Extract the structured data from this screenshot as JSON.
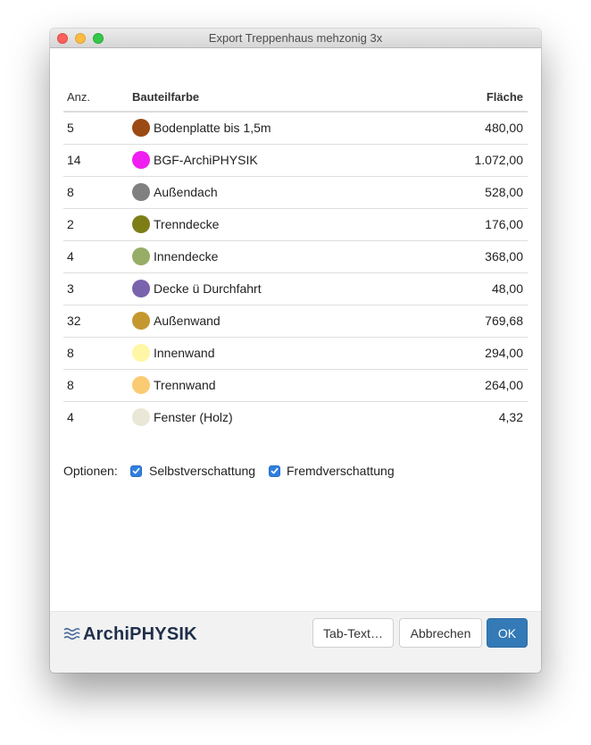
{
  "window": {
    "title": "Export Treppenhaus mehzonig 3x"
  },
  "table": {
    "headers": {
      "anz": "Anz.",
      "farbe": "Bauteilfarbe",
      "flaeche": "Fläche"
    },
    "rows": [
      {
        "anz": "5",
        "name": "Bodenplatte bis 1,5m",
        "value": "480,00",
        "color": "#9a4a12"
      },
      {
        "anz": "14",
        "name": "BGF-ArchiPHYSIK",
        "value": "1.072,00",
        "color": "#f01ef0"
      },
      {
        "anz": "8",
        "name": "Außendach",
        "value": "528,00",
        "color": "#808080"
      },
      {
        "anz": "2",
        "name": "Trenndecke",
        "value": "176,00",
        "color": "#7e7e17"
      },
      {
        "anz": "4",
        "name": "Innendecke",
        "value": "368,00",
        "color": "#97ad66"
      },
      {
        "anz": "3",
        "name": "Decke ü Durchfahrt",
        "value": "48,00",
        "color": "#7a63ad"
      },
      {
        "anz": "32",
        "name": "Außenwand",
        "value": "769,68",
        "color": "#c5972f"
      },
      {
        "anz": "8",
        "name": "Innenwand",
        "value": "294,00",
        "color": "#fff6a6"
      },
      {
        "anz": "8",
        "name": "Trennwand",
        "value": "264,00",
        "color": "#fbcb74"
      },
      {
        "anz": "4",
        "name": "Fenster (Holz)",
        "value": "4,32",
        "color": "#ebe7d6"
      }
    ]
  },
  "options": {
    "label": "Optionen:",
    "selbst": {
      "label": "Selbstverschattung",
      "checked": true
    },
    "fremd": {
      "label": "Fremdverschattung",
      "checked": true
    }
  },
  "footer": {
    "logo_text": "ArchiPHYSIK",
    "logo_icon": "waves-icon",
    "tab_text_label": "Tab-Text…",
    "cancel_label": "Abbrechen",
    "ok_label": "OK"
  },
  "colors": {
    "accent": "#337ab7",
    "checkbox": "#2f7fe0"
  }
}
